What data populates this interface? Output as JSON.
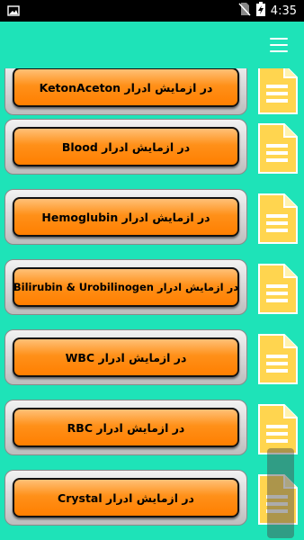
{
  "status_bar": {
    "time": "4:35"
  },
  "app_bar": {
    "menu_icon": "hamburger-menu-icon"
  },
  "items": [
    {
      "name": "ketonaceton",
      "label": "KetonAceton در ازمایش ادرار"
    },
    {
      "name": "blood",
      "label": "Blood  در ازمایش ادرار"
    },
    {
      "name": "hemoglubin",
      "label": "Hemoglubin  در ازمایش ادرار"
    },
    {
      "name": "bilirubin",
      "label": "Bilirubin & Urobilinogen در ازمایش ادرار"
    },
    {
      "name": "wbc",
      "label": "WBC در ازمایش ادرار"
    },
    {
      "name": "rbc",
      "label": "RBC در ازمایش ادرار"
    },
    {
      "name": "crystal",
      "label": "Crystal در ازمایش ادرار"
    }
  ],
  "colors": {
    "background": "#1ee3b8",
    "button_orange": "#ff8c12",
    "doc_icon": "#ffd54f"
  }
}
